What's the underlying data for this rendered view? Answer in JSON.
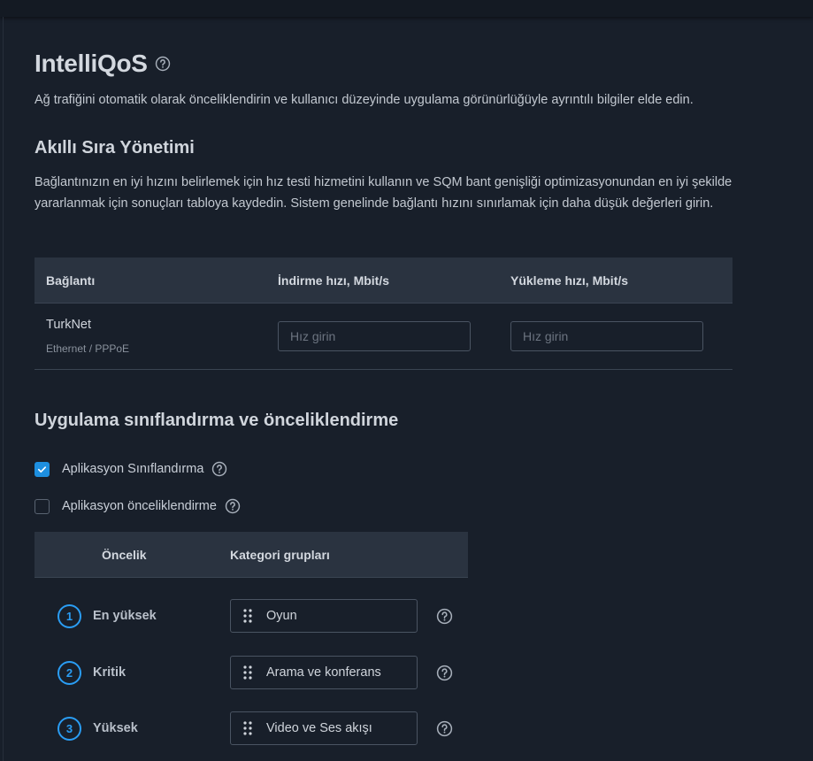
{
  "page": {
    "title": "IntelliQoS",
    "description": "Ağ trafiğini otomatik olarak önceliklendirin ve kullanıcı düzeyinde uygulama görünürlüğüyle ayrıntılı bilgiler elde edin."
  },
  "sqm": {
    "heading": "Akıllı Sıra Yönetimi",
    "description": "Bağlantınızın en iyi hızını belirlemek için hız testi hizmetini kullanın ve SQM bant genişliği optimizasyonundan en iyi şekilde yararlanmak için sonuçları tabloya kaydedin. Sistem genelinde bağlantı hızını sınırlamak için daha düşük değerleri girin.",
    "table": {
      "columns": [
        "Bağlantı",
        "İndirme hızı, Mbit/s",
        "Yükleme hızı, Mbit/s"
      ],
      "rows": [
        {
          "name": "TurkNet",
          "type": "Ethernet / PPPoE",
          "download_value": "",
          "download_placeholder": "Hız girin",
          "upload_value": "",
          "upload_placeholder": "Hız girin"
        }
      ]
    }
  },
  "classification": {
    "heading": "Uygulama sınıflandırma ve önceliklendirme",
    "options": [
      {
        "label": "Aplikasyon Sınıflandırma",
        "checked": true
      },
      {
        "label": "Aplikasyon önceliklendirme",
        "checked": false
      }
    ],
    "priority_table": {
      "columns": [
        "Öncelik",
        "Kategori grupları"
      ],
      "rows": [
        {
          "number": "1",
          "priority": "En yüksek",
          "category": "Oyun"
        },
        {
          "number": "2",
          "priority": "Kritik",
          "category": "Arama ve konferans"
        },
        {
          "number": "3",
          "priority": "Yüksek",
          "category": "Video ve Ses akışı"
        }
      ]
    }
  },
  "colors": {
    "background": "#181f2a",
    "header_bg": "#2a3340",
    "accent": "#1d8fe0"
  }
}
